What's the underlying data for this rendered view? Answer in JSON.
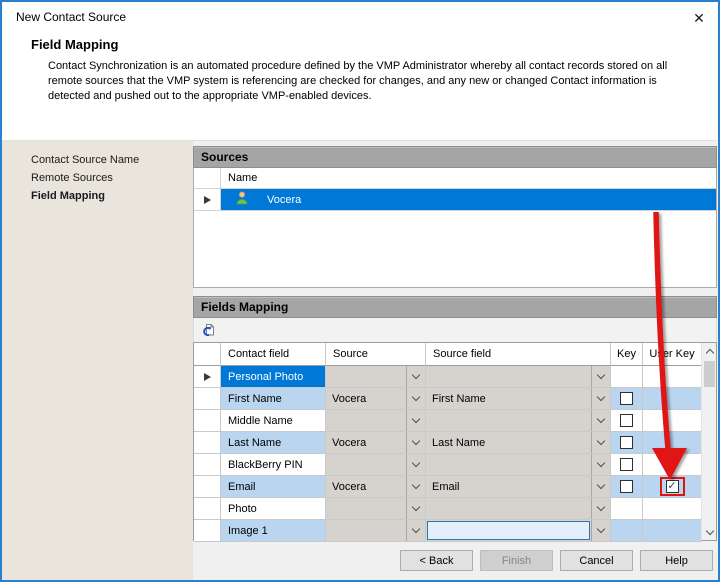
{
  "window": {
    "title": "New Contact Source",
    "close_glyph": "✕"
  },
  "header": {
    "title": "Field Mapping",
    "description": "Contact Synchronization is an automated procedure defined by the VMP Administrator whereby all contact records stored on all remote sources that the VMP system is referencing are checked for changes, and any new or changed Contact information is detected and pushed out to the appropriate VMP-enabled devices."
  },
  "sidebar": {
    "items": [
      {
        "label": "Contact Source Name",
        "active": false
      },
      {
        "label": "Remote Sources",
        "active": false
      },
      {
        "label": "Field Mapping",
        "active": true
      }
    ]
  },
  "sources_panel": {
    "title": "Sources",
    "columns": [
      "Name"
    ],
    "rows": [
      {
        "name": "Vocera",
        "selected": true,
        "icon": "person-icon"
      }
    ]
  },
  "fields_panel": {
    "title": "Fields Mapping",
    "toolbar_icon": "sync-contacts-icon",
    "check_glyph": "✓",
    "columns": [
      "Contact field",
      "Source",
      "Source field",
      "Key",
      "User Key"
    ],
    "rows": [
      {
        "contact_field": "Personal Photo",
        "source": "",
        "source_field": "",
        "key": null,
        "user_key": null,
        "selected": true,
        "striped": false
      },
      {
        "contact_field": "First Name",
        "source": "Vocera",
        "source_field": "First Name",
        "key": false,
        "user_key": null,
        "selected": false,
        "striped": true
      },
      {
        "contact_field": "Middle Name",
        "source": "",
        "source_field": "",
        "key": false,
        "user_key": null,
        "selected": false,
        "striped": false
      },
      {
        "contact_field": "Last Name",
        "source": "Vocera",
        "source_field": "Last Name",
        "key": false,
        "user_key": null,
        "selected": false,
        "striped": true
      },
      {
        "contact_field": "BlackBerry PIN",
        "source": "",
        "source_field": "",
        "key": false,
        "user_key": null,
        "selected": false,
        "striped": false
      },
      {
        "contact_field": "Email",
        "source": "Vocera",
        "source_field": "Email",
        "key": false,
        "user_key": true,
        "user_key_highlighted": true,
        "selected": false,
        "striped": true
      },
      {
        "contact_field": "Photo",
        "source": "",
        "source_field": "",
        "key": null,
        "user_key": null,
        "selected": false,
        "striped": false
      },
      {
        "contact_field": "Image 1",
        "source": "",
        "source_field": "",
        "key": null,
        "user_key": null,
        "selected": false,
        "striped": true,
        "source_field_editing": true
      }
    ]
  },
  "footer": {
    "buttons": [
      {
        "label": "< Back",
        "enabled": true
      },
      {
        "label": "Finish",
        "enabled": false
      },
      {
        "label": "Cancel",
        "enabled": true
      },
      {
        "label": "Help",
        "enabled": true
      }
    ]
  },
  "annotation": {
    "description": "red arrow pointing to checked User Key checkbox on Email row",
    "color": "#e01212"
  },
  "colors": {
    "window_border": "#2a7fd0",
    "selection_blue": "#0078d7",
    "stripe_blue": "#b9d5f0",
    "panel_header_gray": "#a5a5a5",
    "sidebar_bg": "#e9e5dd",
    "dropdown_gray": "#d6d3ce",
    "annotation_red": "#e01212"
  }
}
